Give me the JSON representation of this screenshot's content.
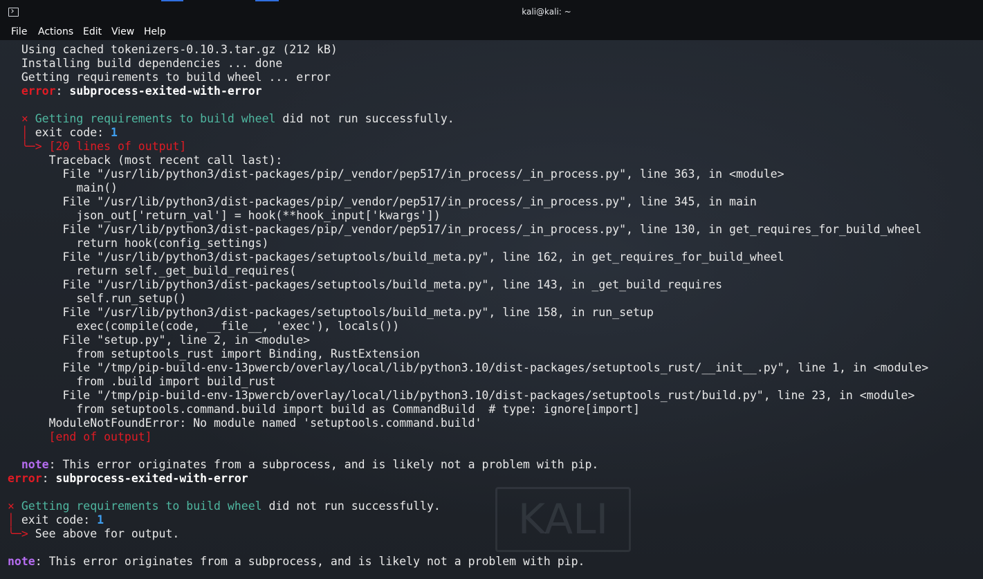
{
  "window": {
    "title": "kali@kali: ~"
  },
  "menu": {
    "items": [
      "File",
      "Actions",
      "Edit",
      "View",
      "Help"
    ]
  },
  "watermark": {
    "text": "KALI"
  },
  "colors": {
    "error": "#e01b24",
    "teal": "#4fb7a0",
    "blue": "#3f9ff0",
    "purple": "#b56cf0",
    "text": "#e8e8e8",
    "background": "#1f232a"
  },
  "terminal": {
    "lines": [
      {
        "segments": [
          {
            "t": "  Using cached tokenizers-0.10.3.tar.gz (212 kB)"
          }
        ]
      },
      {
        "segments": [
          {
            "t": "  Installing build dependencies ... done"
          }
        ]
      },
      {
        "segments": [
          {
            "t": "  Getting requirements to build wheel ... error"
          }
        ]
      },
      {
        "segments": [
          {
            "t": "  "
          },
          {
            "t": "error",
            "c": "c-redb"
          },
          {
            "t": ": "
          },
          {
            "t": "subprocess-exited-with-error",
            "c": "c-bold"
          }
        ]
      },
      {
        "segments": [
          {
            "t": ""
          }
        ]
      },
      {
        "segments": [
          {
            "t": "  "
          },
          {
            "t": "×",
            "c": "c-red"
          },
          {
            "t": " "
          },
          {
            "t": "Getting requirements to build wheel",
            "c": "c-teal"
          },
          {
            "t": " did not run successfully."
          }
        ]
      },
      {
        "segments": [
          {
            "t": "  "
          },
          {
            "t": "│",
            "c": "c-red"
          },
          {
            "t": " exit code: "
          },
          {
            "t": "1",
            "c": "c-blue"
          }
        ]
      },
      {
        "segments": [
          {
            "t": "  "
          },
          {
            "t": "╰─>",
            "c": "c-red"
          },
          {
            "t": " "
          },
          {
            "t": "[20 lines of output]",
            "c": "c-red"
          }
        ]
      },
      {
        "segments": [
          {
            "t": "      Traceback (most recent call last):"
          }
        ]
      },
      {
        "segments": [
          {
            "t": "        File \"/usr/lib/python3/dist-packages/pip/_vendor/pep517/in_process/_in_process.py\", line 363, in <module>"
          }
        ]
      },
      {
        "segments": [
          {
            "t": "          main()"
          }
        ]
      },
      {
        "segments": [
          {
            "t": "        File \"/usr/lib/python3/dist-packages/pip/_vendor/pep517/in_process/_in_process.py\", line 345, in main"
          }
        ]
      },
      {
        "segments": [
          {
            "t": "          json_out['return_val'] = hook(**hook_input['kwargs'])"
          }
        ]
      },
      {
        "segments": [
          {
            "t": "        File \"/usr/lib/python3/dist-packages/pip/_vendor/pep517/in_process/_in_process.py\", line 130, in get_requires_for_build_wheel"
          }
        ]
      },
      {
        "segments": [
          {
            "t": "          return hook(config_settings)"
          }
        ]
      },
      {
        "segments": [
          {
            "t": "        File \"/usr/lib/python3/dist-packages/setuptools/build_meta.py\", line 162, in get_requires_for_build_wheel"
          }
        ]
      },
      {
        "segments": [
          {
            "t": "          return self._get_build_requires("
          }
        ]
      },
      {
        "segments": [
          {
            "t": "        File \"/usr/lib/python3/dist-packages/setuptools/build_meta.py\", line 143, in _get_build_requires"
          }
        ]
      },
      {
        "segments": [
          {
            "t": "          self.run_setup()"
          }
        ]
      },
      {
        "segments": [
          {
            "t": "        File \"/usr/lib/python3/dist-packages/setuptools/build_meta.py\", line 158, in run_setup"
          }
        ]
      },
      {
        "segments": [
          {
            "t": "          exec(compile(code, __file__, 'exec'), locals())"
          }
        ]
      },
      {
        "segments": [
          {
            "t": "        File \"setup.py\", line 2, in <module>"
          }
        ]
      },
      {
        "segments": [
          {
            "t": "          from setuptools_rust import Binding, RustExtension"
          }
        ]
      },
      {
        "segments": [
          {
            "t": "        File \"/tmp/pip-build-env-13pwercb/overlay/local/lib/python3.10/dist-packages/setuptools_rust/__init__.py\", line 1, in <module>"
          }
        ]
      },
      {
        "segments": [
          {
            "t": "          from .build import build_rust"
          }
        ]
      },
      {
        "segments": [
          {
            "t": "        File \"/tmp/pip-build-env-13pwercb/overlay/local/lib/python3.10/dist-packages/setuptools_rust/build.py\", line 23, in <module>"
          }
        ]
      },
      {
        "segments": [
          {
            "t": "          from setuptools.command.build import build as CommandBuild  # type: ignore[import]"
          }
        ]
      },
      {
        "segments": [
          {
            "t": "      ModuleNotFoundError: No module named 'setuptools.command.build'"
          }
        ]
      },
      {
        "segments": [
          {
            "t": "      "
          },
          {
            "t": "[end of output]",
            "c": "c-red"
          }
        ]
      },
      {
        "segments": [
          {
            "t": ""
          }
        ]
      },
      {
        "segments": [
          {
            "t": "  "
          },
          {
            "t": "note",
            "c": "c-purple"
          },
          {
            "t": ": This error originates from a subprocess, and is likely not a problem with pip."
          }
        ]
      },
      {
        "segments": [
          {
            "t": "error",
            "c": "c-redb"
          },
          {
            "t": ": "
          },
          {
            "t": "subprocess-exited-with-error",
            "c": "c-bold"
          }
        ]
      },
      {
        "segments": [
          {
            "t": ""
          }
        ]
      },
      {
        "segments": [
          {
            "t": "×",
            "c": "c-red"
          },
          {
            "t": " "
          },
          {
            "t": "Getting requirements to build wheel",
            "c": "c-teal"
          },
          {
            "t": " did not run successfully."
          }
        ]
      },
      {
        "segments": [
          {
            "t": "│",
            "c": "c-red"
          },
          {
            "t": " exit code: "
          },
          {
            "t": "1",
            "c": "c-blue"
          }
        ]
      },
      {
        "segments": [
          {
            "t": "╰─>",
            "c": "c-red"
          },
          {
            "t": " See above for output."
          }
        ]
      },
      {
        "segments": [
          {
            "t": ""
          }
        ]
      },
      {
        "segments": [
          {
            "t": "note",
            "c": "c-purple"
          },
          {
            "t": ": This error originates from a subprocess, and is likely not a problem with pip."
          }
        ]
      }
    ]
  }
}
